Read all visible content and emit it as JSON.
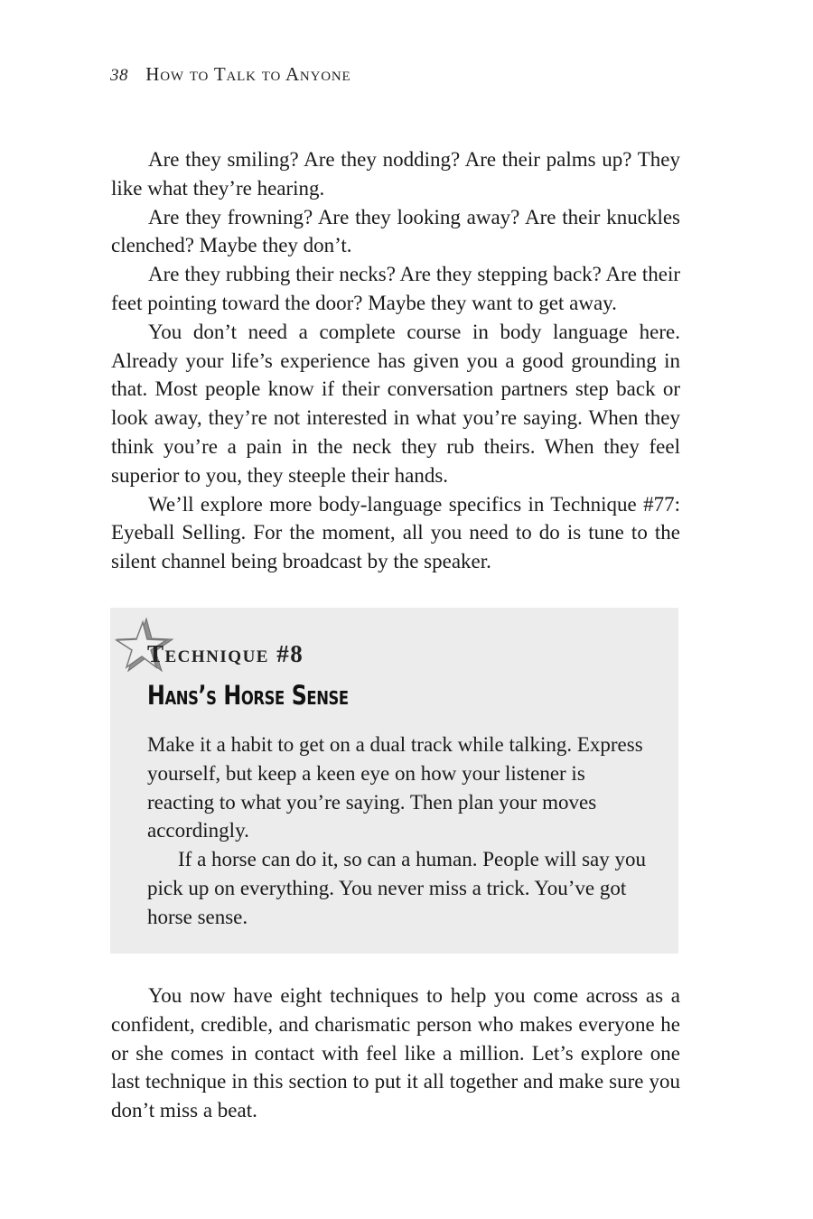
{
  "header": {
    "page_number": "38",
    "book_title": "How to Talk to Anyone"
  },
  "top_paragraphs": [
    "Are they smiling? Are they nodding? Are their palms up? They like what they’re hearing.",
    "Are they frowning? Are they looking away? Are their knuck­les clenched? Maybe they don’t.",
    "Are they rubbing their necks? Are they stepping back? Are their feet pointing toward the door? Maybe they want to get away.",
    "You don’t need a complete course in body language here. Already your life’s experience has given you a good grounding in that. Most people know if their conversation partners step back or look away, they’re not interested in what you’re saying. When they think you’re a pain in the neck they rub theirs. When they feel superior to you, they steeple their hands.",
    "We’ll explore more body-language specifics in Technique #77: Eyeball Selling. For the moment, all you need to do is tune to the silent channel being broadcast by the speaker."
  ],
  "technique": {
    "icon": "star-icon",
    "label": "Technique #8",
    "title": "Hans’s Horse Sense",
    "paragraphs": [
      "Make it a habit to get on a dual track while talking. Express yourself, but keep a keen eye on how your listener is reacting to what you’re saying. Then plan your moves accordingly.",
      "If a horse can do it, so can a human. People will say you pick up on everything. You never miss a trick. You’ve got horse sense."
    ]
  },
  "bottom_paragraphs": [
    "You now have eight techniques to help you come across as a confident, credible, and charismatic person who makes everyone he or she comes in contact with feel like a million. Let’s explore one last technique in this section to put it all together and make sure you don’t miss a beat."
  ],
  "colors": {
    "box_background": "#ececec",
    "star_fill": "#9a9a9a"
  }
}
